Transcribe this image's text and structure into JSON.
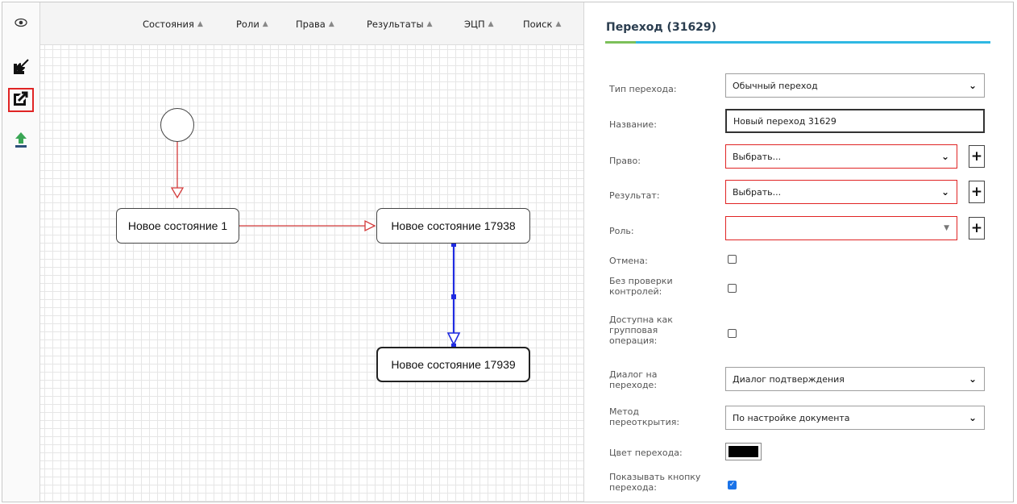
{
  "left_toolbar": {
    "items": [
      {
        "icon": "eye-icon"
      },
      {
        "icon": "import-arrow-icon"
      },
      {
        "icon": "export-arrow-icon",
        "active": true
      },
      {
        "icon": "upload-icon"
      }
    ]
  },
  "menu": {
    "items": [
      {
        "label": "Состояния"
      },
      {
        "label": "Роли"
      },
      {
        "label": "Права"
      },
      {
        "label": "Результаты"
      },
      {
        "label": "ЭЦП"
      },
      {
        "label": "Поиск"
      }
    ]
  },
  "diagram": {
    "nodes": [
      {
        "label": "Новое состояние 1"
      },
      {
        "label": "Новое состояние 17938"
      },
      {
        "label": "Новое состояние 17939",
        "selected": true
      }
    ],
    "colors": {
      "edge": "#d43a3a",
      "selected_edge": "#1f2be0"
    }
  },
  "props": {
    "title": "Переход (31629)",
    "fields": {
      "type": {
        "label": "Тип перехода:",
        "value": "Обычный переход"
      },
      "name": {
        "label": "Название:",
        "value": "Новый переход 31629"
      },
      "right": {
        "label": "Право:",
        "value": "Выбрать..."
      },
      "result": {
        "label": "Результат:",
        "value": "Выбрать..."
      },
      "role": {
        "label": "Роль:",
        "value": ""
      },
      "cancel": {
        "label": "Отмена:",
        "checked": false
      },
      "no_check": {
        "label1": "Без проверки",
        "label2": "контролей:",
        "checked": false
      },
      "group_op": {
        "label1": "Доступна как",
        "label2": "групповая",
        "label3": "операция:",
        "checked": false
      },
      "dialog": {
        "label1": "Диалог на",
        "label2": "переходе:",
        "value": "Диалог подтверждения"
      },
      "reopen": {
        "label1": "Метод",
        "label2": "переоткрытия:",
        "value": "По настройке документа"
      },
      "color": {
        "label": "Цвет перехода:",
        "value": "#000000"
      },
      "show_button": {
        "label1": "Показывать кнопку",
        "label2": "перехода:",
        "checked": true
      }
    }
  }
}
